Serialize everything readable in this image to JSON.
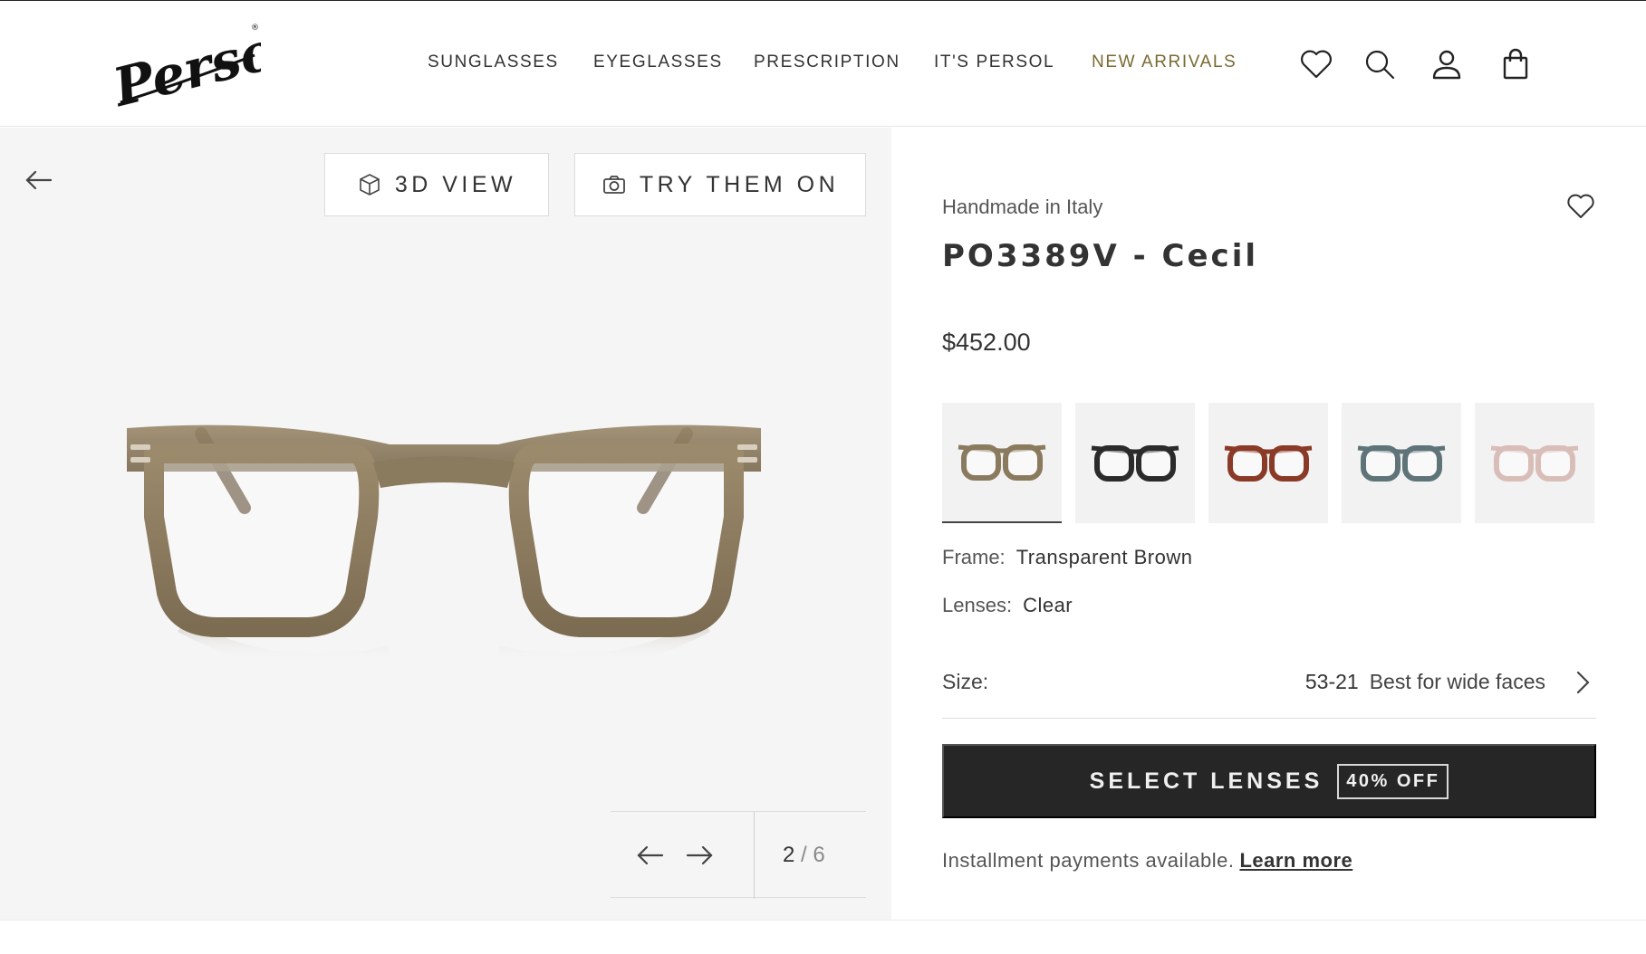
{
  "brand": {
    "logo_text": "Persol",
    "logo_mark": "®"
  },
  "nav": {
    "items": [
      {
        "label": "SUNGLASSES"
      },
      {
        "label": "EYEGLASSES"
      },
      {
        "label": "PRESCRIPTION"
      },
      {
        "label": "IT'S PERSOL"
      },
      {
        "label": "NEW ARRIVALS"
      }
    ],
    "icons": [
      "heart-icon",
      "search-icon",
      "user-icon",
      "shopping-bag-icon"
    ]
  },
  "gallery": {
    "view_3d_label": "3D VIEW",
    "try_on_label": "TRY THEM ON",
    "current_index": "2",
    "separator": "/",
    "total": "6"
  },
  "product": {
    "origin": "Handmade in Italy",
    "title": "PO3389V - Cecil",
    "price": "$452.00",
    "swatches": [
      {
        "name": "Transparent Brown",
        "color": "#8a7a5e",
        "selected": true
      },
      {
        "name": "Black",
        "color": "#2b2b2b",
        "selected": false
      },
      {
        "name": "Havana",
        "color": "#8a3a26",
        "selected": false
      },
      {
        "name": "Grey Blue",
        "color": "#5f7478",
        "selected": false
      },
      {
        "name": "Pink",
        "color": "#d9bdb8",
        "selected": false
      }
    ],
    "frame_label": "Frame:",
    "frame_value": "Transparent Brown",
    "lenses_label": "Lenses:",
    "lenses_value": "Clear",
    "size_label": "Size:",
    "size_value": "53-21",
    "size_fit": "Best for wide faces",
    "select_lenses_label": "SELECT LENSES",
    "discount_badge": "40% OFF",
    "installment_text": "Installment payments available.",
    "learn_more": "Learn more"
  },
  "colors": {
    "nav_highlight": "#7a6a32",
    "cta_background": "#262626",
    "gallery_background": "#f5f5f5"
  }
}
